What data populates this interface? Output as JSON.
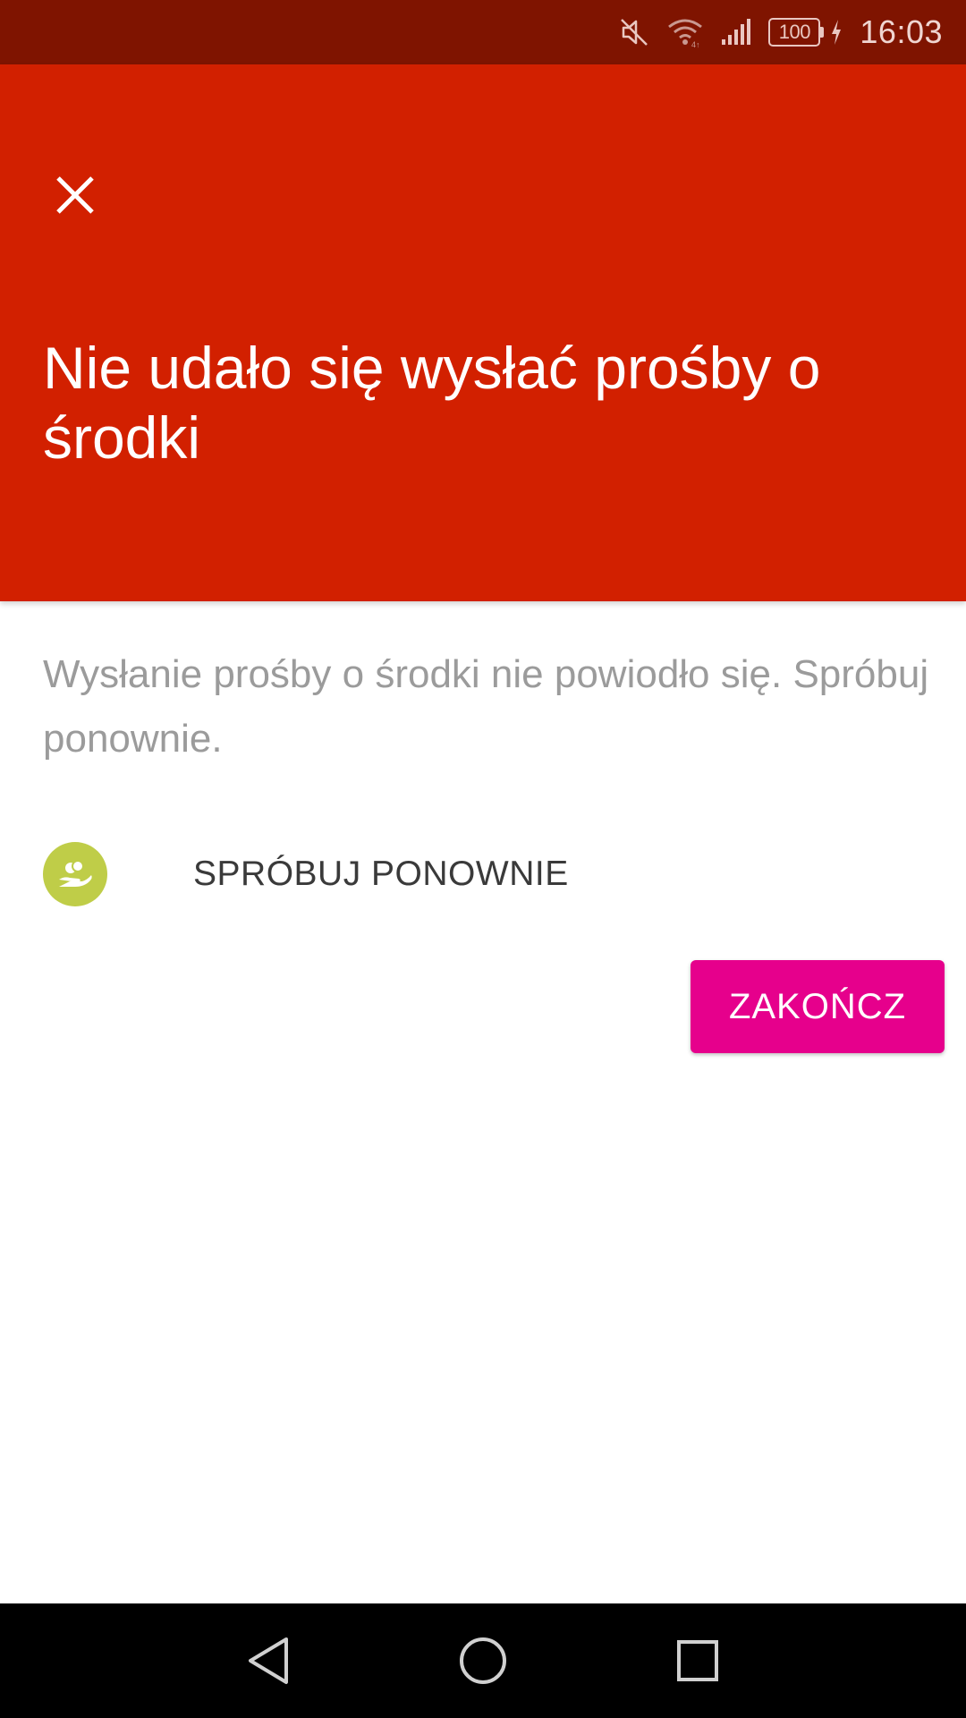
{
  "status_bar": {
    "time": "16:03",
    "battery_level": "100",
    "icons": [
      "mute-icon",
      "wifi-icon",
      "signal-icon",
      "battery-icon",
      "charging-icon"
    ]
  },
  "header": {
    "title": "Nie udało się wysłać prośby o środki",
    "background_color": "#d22000",
    "close_icon": "close-icon"
  },
  "body": {
    "message": "Wysłanie prośby o środki nie powiodło się. Spróbuj ponownie.",
    "retry_label": "SPRÓBUJ PONOWNIE",
    "retry_icon": "hand-coins-icon",
    "retry_icon_color": "#bfcd48",
    "finish_label": "ZAKOŃCZ",
    "finish_color": "#e6008c"
  },
  "nav_bar": {
    "icons": [
      "back-icon",
      "home-icon",
      "recents-icon"
    ]
  }
}
